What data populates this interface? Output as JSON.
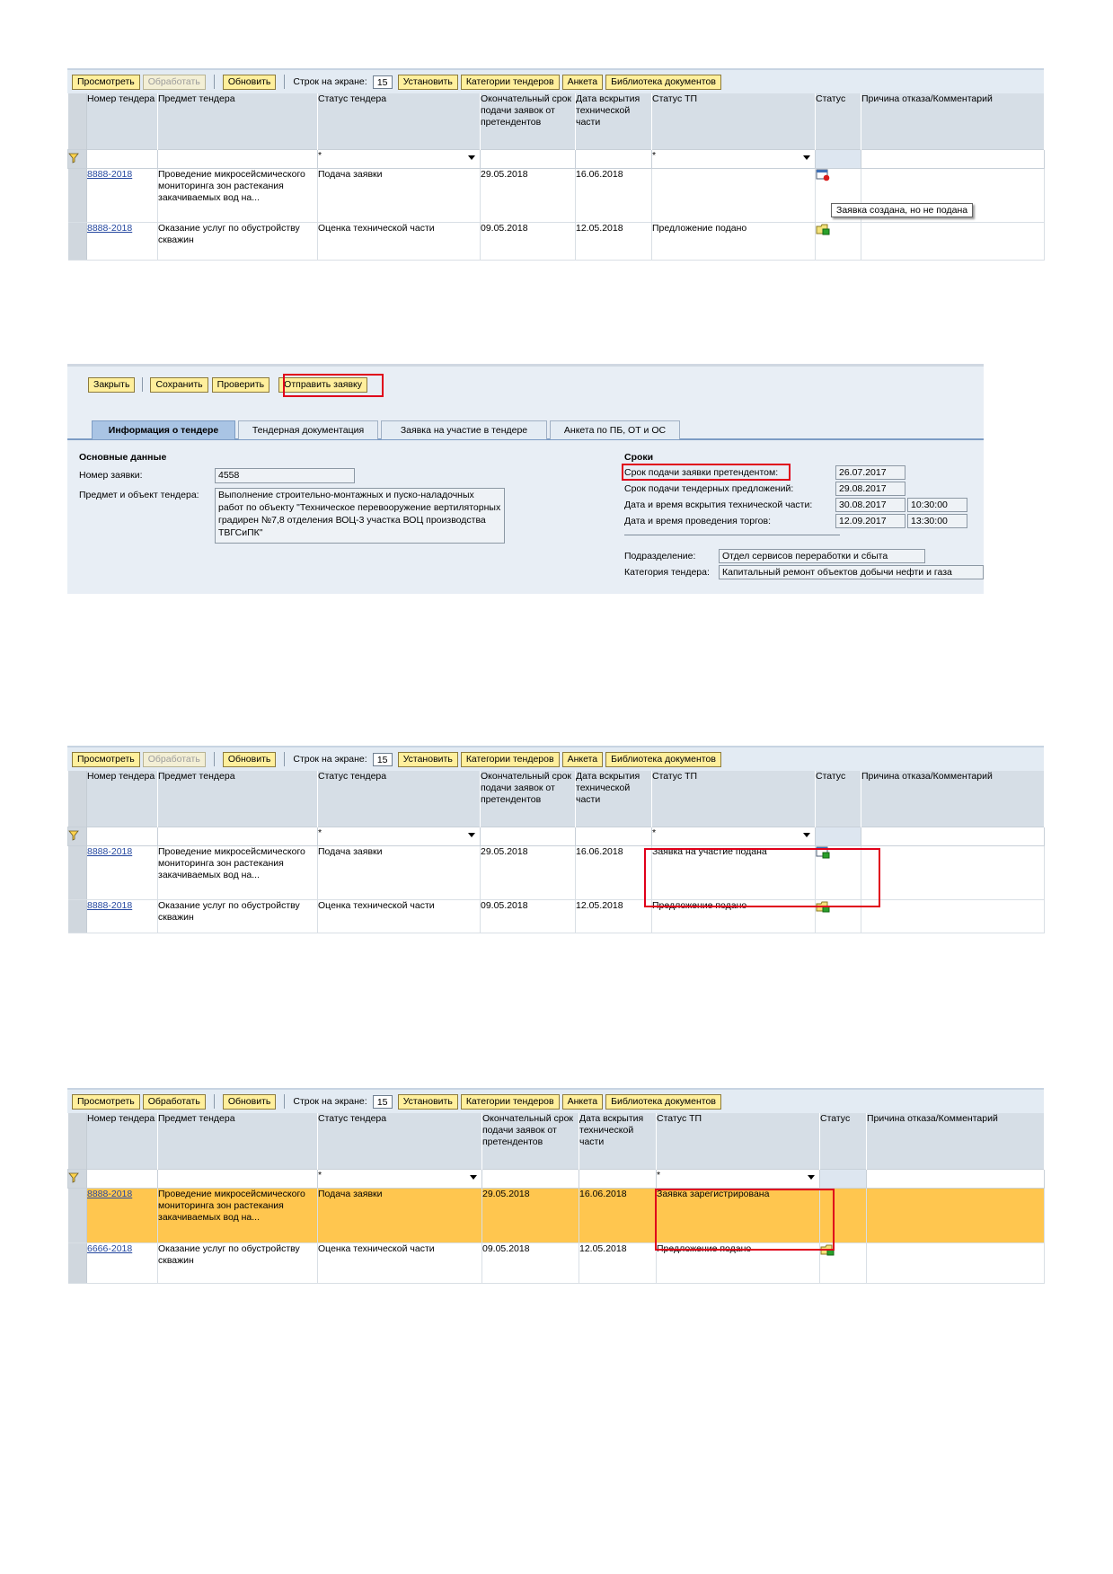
{
  "list_toolbar": {
    "view": "Просмотреть",
    "process": "Обработать",
    "refresh": "Обновить",
    "rows_label": "Строк на экране:",
    "rows_value": "15",
    "set": "Установить",
    "categories": "Категории тендеров",
    "survey": "Анкета",
    "library": "Библиотека документов"
  },
  "columns": {
    "number": "Номер тендера",
    "subject": "Предмет тендера",
    "status": "Статус тендера",
    "deadline": "Окончательный срок подачи заявок от претендентов",
    "opening": "Дата вскрытия технической части",
    "tp_status": "Статус ТП",
    "state": "Статус",
    "reason": "Причина отказа/Комментарий"
  },
  "filter": {
    "status": "*",
    "tp_status": "*"
  },
  "table1": {
    "rows": [
      {
        "number": "8888-2018",
        "subject": "Проведение микросейсмического мониторинга зон растекания закачиваемых вод на...",
        "status": "Подача заявки",
        "deadline": "29.05.2018",
        "opening": "16.06.2018",
        "tp_status": "",
        "icon": "draft-not-submitted-icon"
      },
      {
        "number": "8888-2018",
        "subject": "Оказание услуг по обустройству скважин",
        "status": "Оценка технической части",
        "deadline": "09.05.2018",
        "opening": "12.05.2018",
        "tp_status": "Предложение подано",
        "icon": "submitted-icon"
      }
    ],
    "tooltip": "Заявка создана, но не подана"
  },
  "form": {
    "toolbar": {
      "close": "Закрыть",
      "save": "Сохранить",
      "check": "Проверить",
      "send": "Отправить заявку"
    },
    "tabs": [
      "Информация о тендере",
      "Тендерная документация",
      "Заявка на участие в тендере",
      "Анкета по ПБ, ОТ и ОС"
    ],
    "main_title": "Основные данные",
    "request_no_label": "Номер заявки:",
    "request_no": "4558",
    "subject_label": "Предмет и объект тендера:",
    "subject": "Выполнение строительно-монтажных и пуско-наладочных работ по объекту \"Техническое перевооружение вертиляторных градирен №7,8 отделения ВОЦ-3 участка ВОЦ производства ТВГСиПК\"",
    "terms_title": "Сроки",
    "terms": [
      {
        "label": "Срок подачи заявки претендентом:",
        "date": "26.07.2017",
        "time": ""
      },
      {
        "label": "Срок подачи тендерных предложений:",
        "date": "29.08.2017",
        "time": ""
      },
      {
        "label": "Дата и время вскрытия технической части:",
        "date": "30.08.2017",
        "time": "10:30:00"
      },
      {
        "label": "Дата и время проведения торгов:",
        "date": "12.09.2017",
        "time": "13:30:00"
      }
    ],
    "division_label": "Подразделение:",
    "division": "Отдел сервисов переработки и сбыта",
    "category_label": "Категория тендера:",
    "category": "Капитальный ремонт объектов добычи нефти и газа"
  },
  "table2": {
    "rows": [
      {
        "number": "8888-2018",
        "subject": "Проведение микросейсмического мониторинга зон растекания закачиваемых вод на...",
        "status": "Подача заявки",
        "deadline": "29.05.2018",
        "opening": "16.06.2018",
        "tp_status": "Заявка на участие подана",
        "icon": "submitted-icon"
      },
      {
        "number": "8888-2018",
        "subject": "Оказание услуг по обустройству скважин",
        "status": "Оценка технической части",
        "deadline": "09.05.2018",
        "opening": "12.05.2018",
        "tp_status": "Предложение подано",
        "icon": "submitted-icon"
      }
    ]
  },
  "table3": {
    "rows": [
      {
        "number": "8888-2018",
        "subject": "Проведение микросейсмического мониторинга зон растекания закачиваемых вод на...",
        "status": "Подача заявки",
        "deadline": "29.05.2018",
        "opening": "16.06.2018",
        "tp_status": "Заявка зарегистрирована",
        "icon": ""
      },
      {
        "number": "6666-2018",
        "subject": "Оказание услуг по обустройству скважин",
        "status": "Оценка технической части",
        "deadline": "09.05.2018",
        "opening": "12.05.2018",
        "tp_status": "Предложение подано",
        "icon": "submitted-icon"
      }
    ]
  },
  "colors": {
    "button": "#ffef9c",
    "highlight_row": "#ffc64f",
    "annotation": "#e0001a",
    "link": "#2548a0"
  }
}
